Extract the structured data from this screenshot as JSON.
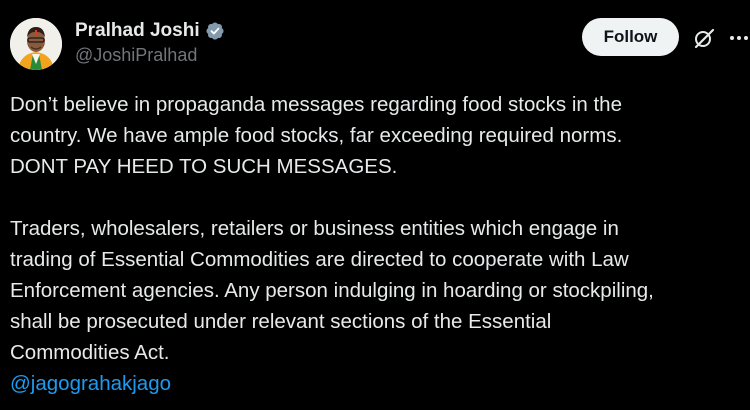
{
  "author": {
    "display_name": "Pralhad Joshi",
    "handle": "@JoshiPralhad",
    "verified_icon": "verified-badge-icon",
    "verified_color": "#829aab"
  },
  "actions": {
    "follow_label": "Follow",
    "grok_icon": "grok-icon",
    "more_icon": "more-options-icon"
  },
  "tweet": {
    "paragraph1": [
      "Don’t believe in propaganda messages regarding food stocks in the",
      "country. We have ample food stocks, far exceeding required norms.",
      "DONT PAY HEED TO SUCH MESSAGES."
    ],
    "paragraph2": [
      "Traders, wholesalers, retailers or business entities which engage in",
      "trading of Essential Commodities are directed to cooperate with Law",
      "Enforcement agencies. Any person indulging in hoarding or stockpiling,",
      "shall be prosecuted under relevant sections of the Essential",
      "Commodities Act."
    ],
    "mention": "@jagograhakjago"
  },
  "colors": {
    "background": "#000000",
    "text": "#e7e9ea",
    "secondary_text": "#71767b",
    "link": "#1d9bf0",
    "follow_bg": "#eff3f4"
  }
}
